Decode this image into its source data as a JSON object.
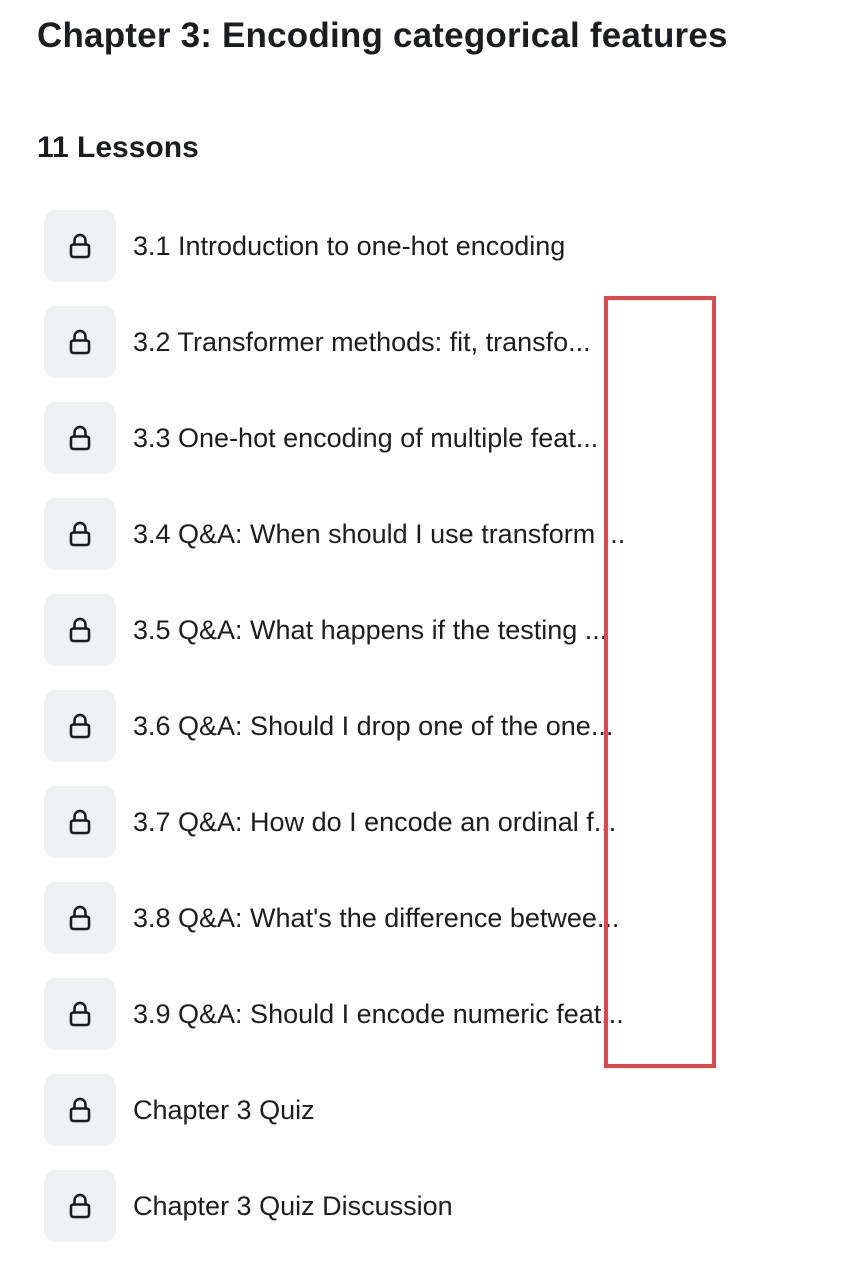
{
  "chapter": {
    "title": "Chapter 3: Encoding categorical features",
    "lessons_count_label": "11 Lessons"
  },
  "lessons": [
    {
      "label": "3.1 Introduction to one-hot encoding",
      "icon": "lock-icon",
      "locked": true
    },
    {
      "label": "3.2 Transformer methods: fit, transfo...",
      "icon": "lock-icon",
      "locked": true
    },
    {
      "label": "3.3 One-hot encoding of multiple feat...",
      "icon": "lock-icon",
      "locked": true
    },
    {
      "label": "3.4 Q&A: When should I use transform ...",
      "icon": "lock-icon",
      "locked": true
    },
    {
      "label": "3.5 Q&A: What happens if the testing ...",
      "icon": "lock-icon",
      "locked": true
    },
    {
      "label": "3.6 Q&A: Should I drop one of the one...",
      "icon": "lock-icon",
      "locked": true
    },
    {
      "label": "3.7 Q&A: How do I encode an ordinal f...",
      "icon": "lock-icon",
      "locked": true
    },
    {
      "label": "3.8 Q&A: What's the difference betwee...",
      "icon": "lock-icon",
      "locked": true
    },
    {
      "label": "3.9 Q&A: Should I encode numeric feat...",
      "icon": "lock-icon",
      "locked": true
    },
    {
      "label": "Chapter 3 Quiz",
      "icon": "lock-icon",
      "locked": true
    },
    {
      "label": "Chapter 3 Quiz Discussion",
      "icon": "lock-icon",
      "locked": true
    }
  ],
  "colors": {
    "text": "#1c1d21",
    "icon_background": "#eef0f2",
    "highlight_border": "#e0474c"
  }
}
